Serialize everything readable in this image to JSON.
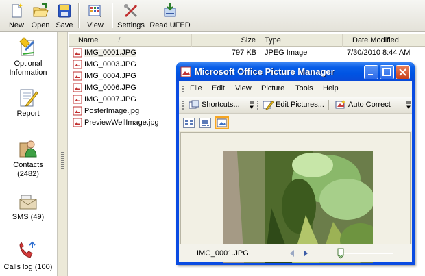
{
  "toolbar": {
    "new_label": "New",
    "open_label": "Open",
    "save_label": "Save",
    "view_label": "View",
    "settings_label": "Settings",
    "read_ufed_label": "Read UFED"
  },
  "leftnav": {
    "optional_info": "Optional Information",
    "report": "Report",
    "contacts": "Contacts (2482)",
    "sms": "SMS (49)",
    "calls_log": "Calls log (100)"
  },
  "filelist": {
    "columns": {
      "name": "Name",
      "size": "Size",
      "type": "Type",
      "date": "Date Modified"
    },
    "sort_indicator": "/",
    "files": [
      {
        "name": "IMG_0001.JPG",
        "size": "797 KB",
        "type": "JPEG Image",
        "date": "7/30/2010 8:44 AM"
      },
      {
        "name": "IMG_0003.JPG",
        "size": "",
        "type": "",
        "date": ""
      },
      {
        "name": "IMG_0004.JPG",
        "size": "",
        "type": "",
        "date": ""
      },
      {
        "name": "IMG_0006.JPG",
        "size": "",
        "type": "",
        "date": ""
      },
      {
        "name": "IMG_0007.JPG",
        "size": "",
        "type": "",
        "date": ""
      },
      {
        "name": "PosterImage.jpg",
        "size": "",
        "type": "",
        "date": ""
      },
      {
        "name": "PreviewWellImage.jpg",
        "size": "",
        "type": "",
        "date": ""
      }
    ]
  },
  "picture_manager": {
    "title": "Microsoft Office Picture Manager",
    "menu": [
      "File",
      "Edit",
      "View",
      "Picture",
      "Tools",
      "Help"
    ],
    "shortcuts_label": "Shortcuts...",
    "edit_pictures_label": "Edit Pictures...",
    "auto_correct_label": "Auto Correct",
    "status_filename": "IMG_0001.JPG",
    "zoom_level": 0.05
  },
  "colors": {
    "title_blue": "#0054e3",
    "selected_view": "#fdd597"
  }
}
